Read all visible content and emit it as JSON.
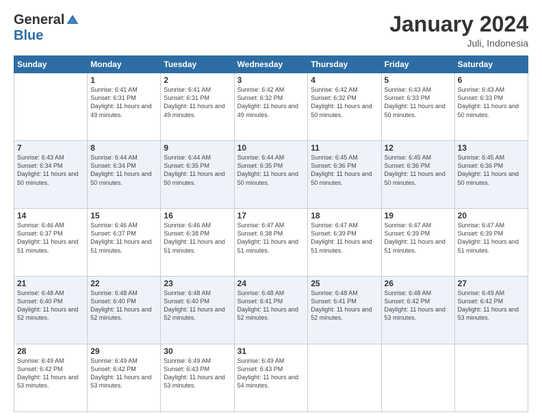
{
  "header": {
    "logo_general": "General",
    "logo_blue": "Blue",
    "title": "January 2024",
    "subtitle": "Juli, Indonesia"
  },
  "weekdays": [
    "Sunday",
    "Monday",
    "Tuesday",
    "Wednesday",
    "Thursday",
    "Friday",
    "Saturday"
  ],
  "weeks": [
    [
      {
        "day": "",
        "sunrise": "",
        "sunset": "",
        "daylight": "",
        "empty": true
      },
      {
        "day": "1",
        "sunrise": "6:41 AM",
        "sunset": "6:31 PM",
        "daylight": "11 hours and 49 minutes."
      },
      {
        "day": "2",
        "sunrise": "6:41 AM",
        "sunset": "6:31 PM",
        "daylight": "11 hours and 49 minutes."
      },
      {
        "day": "3",
        "sunrise": "6:42 AM",
        "sunset": "6:32 PM",
        "daylight": "11 hours and 49 minutes."
      },
      {
        "day": "4",
        "sunrise": "6:42 AM",
        "sunset": "6:32 PM",
        "daylight": "11 hours and 50 minutes."
      },
      {
        "day": "5",
        "sunrise": "6:43 AM",
        "sunset": "6:33 PM",
        "daylight": "11 hours and 50 minutes."
      },
      {
        "day": "6",
        "sunrise": "6:43 AM",
        "sunset": "6:33 PM",
        "daylight": "11 hours and 50 minutes."
      }
    ],
    [
      {
        "day": "7",
        "sunrise": "6:43 AM",
        "sunset": "6:34 PM",
        "daylight": "11 hours and 50 minutes."
      },
      {
        "day": "8",
        "sunrise": "6:44 AM",
        "sunset": "6:34 PM",
        "daylight": "11 hours and 50 minutes."
      },
      {
        "day": "9",
        "sunrise": "6:44 AM",
        "sunset": "6:35 PM",
        "daylight": "11 hours and 50 minutes."
      },
      {
        "day": "10",
        "sunrise": "6:44 AM",
        "sunset": "6:35 PM",
        "daylight": "11 hours and 50 minutes."
      },
      {
        "day": "11",
        "sunrise": "6:45 AM",
        "sunset": "6:36 PM",
        "daylight": "11 hours and 50 minutes."
      },
      {
        "day": "12",
        "sunrise": "6:45 AM",
        "sunset": "6:36 PM",
        "daylight": "11 hours and 50 minutes."
      },
      {
        "day": "13",
        "sunrise": "6:45 AM",
        "sunset": "6:36 PM",
        "daylight": "11 hours and 50 minutes."
      }
    ],
    [
      {
        "day": "14",
        "sunrise": "6:46 AM",
        "sunset": "6:37 PM",
        "daylight": "11 hours and 51 minutes."
      },
      {
        "day": "15",
        "sunrise": "6:46 AM",
        "sunset": "6:37 PM",
        "daylight": "11 hours and 51 minutes."
      },
      {
        "day": "16",
        "sunrise": "6:46 AM",
        "sunset": "6:38 PM",
        "daylight": "11 hours and 51 minutes."
      },
      {
        "day": "17",
        "sunrise": "6:47 AM",
        "sunset": "6:38 PM",
        "daylight": "11 hours and 51 minutes."
      },
      {
        "day": "18",
        "sunrise": "6:47 AM",
        "sunset": "6:39 PM",
        "daylight": "11 hours and 51 minutes."
      },
      {
        "day": "19",
        "sunrise": "6:47 AM",
        "sunset": "6:39 PM",
        "daylight": "11 hours and 51 minutes."
      },
      {
        "day": "20",
        "sunrise": "6:47 AM",
        "sunset": "6:39 PM",
        "daylight": "11 hours and 51 minutes."
      }
    ],
    [
      {
        "day": "21",
        "sunrise": "6:48 AM",
        "sunset": "6:40 PM",
        "daylight": "11 hours and 52 minutes."
      },
      {
        "day": "22",
        "sunrise": "6:48 AM",
        "sunset": "6:40 PM",
        "daylight": "11 hours and 52 minutes."
      },
      {
        "day": "23",
        "sunrise": "6:48 AM",
        "sunset": "6:40 PM",
        "daylight": "11 hours and 52 minutes."
      },
      {
        "day": "24",
        "sunrise": "6:48 AM",
        "sunset": "6:41 PM",
        "daylight": "11 hours and 52 minutes."
      },
      {
        "day": "25",
        "sunrise": "6:48 AM",
        "sunset": "6:41 PM",
        "daylight": "11 hours and 52 minutes."
      },
      {
        "day": "26",
        "sunrise": "6:48 AM",
        "sunset": "6:42 PM",
        "daylight": "11 hours and 53 minutes."
      },
      {
        "day": "27",
        "sunrise": "6:49 AM",
        "sunset": "6:42 PM",
        "daylight": "11 hours and 53 minutes."
      }
    ],
    [
      {
        "day": "28",
        "sunrise": "6:49 AM",
        "sunset": "6:42 PM",
        "daylight": "11 hours and 53 minutes."
      },
      {
        "day": "29",
        "sunrise": "6:49 AM",
        "sunset": "6:42 PM",
        "daylight": "11 hours and 53 minutes."
      },
      {
        "day": "30",
        "sunrise": "6:49 AM",
        "sunset": "6:43 PM",
        "daylight": "11 hours and 53 minutes."
      },
      {
        "day": "31",
        "sunrise": "6:49 AM",
        "sunset": "6:43 PM",
        "daylight": "11 hours and 54 minutes."
      },
      {
        "day": "",
        "sunrise": "",
        "sunset": "",
        "daylight": "",
        "empty": true
      },
      {
        "day": "",
        "sunrise": "",
        "sunset": "",
        "daylight": "",
        "empty": true
      },
      {
        "day": "",
        "sunrise": "",
        "sunset": "",
        "daylight": "",
        "empty": true
      }
    ]
  ]
}
